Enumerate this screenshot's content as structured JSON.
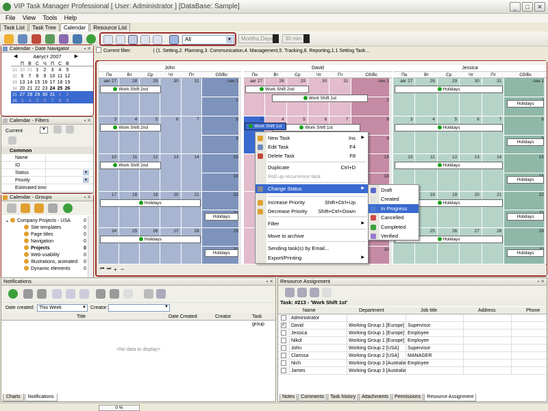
{
  "window": {
    "title": "VIP Task Manager Professional [ User: Administrator ] [DataBase: Sample]"
  },
  "menu": [
    "File",
    "View",
    "Tools",
    "Help"
  ],
  "tabs": [
    "Task List",
    "Task Tree",
    "Calendar",
    "Resource List"
  ],
  "toolbar": {
    "filter_value": "All",
    "view_mode": "Months,Days",
    "interval": "30 min"
  },
  "filter_bar": {
    "current_filter_label": "Current filter:",
    "filter_text": "( (1. Setting,2. Planning,3. Communication,4. Management,5. Tracking,6. Reporting,1.1 Setting Task..."
  },
  "date_navigator": {
    "title": "Calendar - Date Navigator",
    "month": "Август 2007",
    "weekdays": [
      "П",
      "В",
      "С",
      "Ч",
      "П",
      "С",
      "В"
    ],
    "weeks": [
      {
        "num": "31",
        "days": [
          "30",
          "31",
          "1",
          "2",
          "3",
          "4",
          "5"
        ]
      },
      {
        "num": "32",
        "days": [
          "6",
          "7",
          "8",
          "9",
          "10",
          "11",
          "12"
        ]
      },
      {
        "num": "33",
        "days": [
          "13",
          "14",
          "15",
          "16",
          "17",
          "18",
          "19"
        ]
      },
      {
        "num": "34",
        "days": [
          "20",
          "21",
          "22",
          "23",
          "24",
          "25",
          "26"
        ]
      },
      {
        "num": "35",
        "days": [
          "27",
          "28",
          "29",
          "30",
          "31",
          "1",
          "2"
        ]
      },
      {
        "num": "36",
        "days": [
          "3",
          "4",
          "5",
          "6",
          "7",
          "8",
          "9"
        ]
      }
    ]
  },
  "filters_panel": {
    "title": "Calendar - Filters",
    "current_label": "Current",
    "section": "Common",
    "fields": [
      "Name",
      "ID",
      "Status",
      "Priority",
      "Estimated time"
    ]
  },
  "groups_panel": {
    "title": "Calendar - Groups",
    "items": [
      {
        "label": "Company Projects - USA",
        "count": "0",
        "bold": false,
        "level": 0
      },
      {
        "label": "Site templates",
        "count": "0",
        "bold": false,
        "level": 1
      },
      {
        "label": "Page titles",
        "count": "0",
        "bold": false,
        "level": 1
      },
      {
        "label": "Navigation",
        "count": "0",
        "bold": false,
        "level": 1
      },
      {
        "label": "Projects",
        "count": "0",
        "bold": true,
        "level": 1
      },
      {
        "label": "Web-usability",
        "count": "0",
        "bold": false,
        "level": 1
      },
      {
        "label": "Illustrations, animated",
        "count": "0",
        "bold": false,
        "level": 1
      },
      {
        "label": "Dynamic elements",
        "count": "0",
        "bold": false,
        "level": 1
      }
    ]
  },
  "calendar": {
    "days": [
      "Пн",
      "Вт",
      "Ср",
      "Чт",
      "Пт",
      "Сб/Вс"
    ],
    "people": [
      {
        "name": "John",
        "color": "#a7b5d0",
        "weekend": "#7e93bb",
        "events": [
          [
            "Work Shift 2nd"
          ],
          [
            "Work Shift 2nd"
          ],
          [
            "Work Shift 2nd"
          ],
          [
            "Holidays"
          ],
          [
            "Holidays"
          ]
        ]
      },
      {
        "name": "David",
        "color": "#e2bccd",
        "weekend": "#c58ba4",
        "events": [
          [
            "Work Shift 2nd",
            "Work Shift 1st"
          ],
          [
            "Work Shift 1st"
          ],
          [],
          [],
          []
        ]
      },
      {
        "name": "Jessica",
        "color": "#b6d3c8",
        "weekend": "#8fb8a8",
        "events": [
          [
            "Holidays"
          ],
          [
            "Holidays"
          ],
          [
            "Holidays"
          ],
          [
            "Holidays"
          ],
          [
            "Holidays"
          ]
        ]
      }
    ],
    "weeks": [
      [
        "авг 27",
        "28",
        "29",
        "30",
        "31",
        "сен 1",
        "2"
      ],
      [
        "3",
        "4",
        "5",
        "6",
        "7",
        "8",
        "9"
      ],
      [
        "10",
        "11",
        "12",
        "13",
        "14",
        "15",
        "16"
      ],
      [
        "17",
        "18",
        "19",
        "20",
        "21",
        "22",
        "23"
      ],
      [
        "24",
        "25",
        "26",
        "27",
        "28",
        "29",
        "30"
      ]
    ]
  },
  "context_menu": {
    "items": [
      {
        "label": "New Task",
        "shortcut": "Ins",
        "arrow": true
      },
      {
        "label": "Edit Task",
        "shortcut": "F4",
        "arrow": false
      },
      {
        "label": "Delete Task",
        "shortcut": "F8",
        "arrow": false
      },
      {
        "label": "Duplicate",
        "shortcut": "Ctrl+D",
        "arrow": false
      },
      {
        "label": "Roll up recurrence task",
        "shortcut": "",
        "arrow": false
      },
      {
        "label": "Change Status",
        "shortcut": "",
        "arrow": true
      },
      {
        "label": "Increase Priority",
        "shortcut": "Shift+Ctrl+Up",
        "arrow": false
      },
      {
        "label": "Decrease Priority",
        "shortcut": "Shift+Ctrl+Down",
        "arrow": false
      },
      {
        "label": "Filter",
        "shortcut": "",
        "arrow": true
      },
      {
        "label": "Move to archive",
        "shortcut": "",
        "arrow": false
      },
      {
        "label": "Sending task(s) by Email...",
        "shortcut": "",
        "arrow": false
      },
      {
        "label": "Export/Printing",
        "shortcut": "",
        "arrow": true
      }
    ]
  },
  "status_submenu": [
    "Draft",
    "Created",
    "In Progress",
    "Cancelled",
    "Completed",
    "Verified"
  ],
  "notifications": {
    "title": "Notifications",
    "date_label": "Date created:",
    "date_value": "This Week",
    "creator_label": "Creator:",
    "columns": [
      "Title",
      "Date Created",
      "Creator",
      "Task group"
    ],
    "empty": "<No data to display>",
    "tabs": [
      "Charts",
      "Notifications"
    ]
  },
  "resources": {
    "title": "Resource Assignment",
    "task_title": "Task: #213 - 'Work Shift 1st'",
    "columns": [
      "Name",
      "Department",
      "Job title",
      "Address",
      "Phone"
    ],
    "rows": [
      {
        "check": "",
        "name": "Administrator",
        "dept": "",
        "job": ""
      },
      {
        "check": "✓",
        "name": "David",
        "dept": "Working Group 1 [Europe]",
        "job": "Supervisor"
      },
      {
        "check": "",
        "name": "Jessica",
        "dept": "Working Group 1 [Europe]",
        "job": "Employee"
      },
      {
        "check": "",
        "name": "Nikol",
        "dept": "Working Group 1 [Europe]",
        "job": "Employee"
      },
      {
        "check": "",
        "name": "John",
        "dept": "Working Group 2 [USA]",
        "job": "Supervisor"
      },
      {
        "check": "",
        "name": "Clarissa",
        "dept": "Working Group 2 [USA]",
        "job": "MANAGER"
      },
      {
        "check": "",
        "name": "Nich",
        "dept": "Working Group 3 [Australia]",
        "job": "Employee"
      },
      {
        "check": "",
        "name": "James",
        "dept": "Working Group 3 [Australia]",
        "job": ""
      }
    ],
    "tabs": [
      "Notes",
      "Comments",
      "Task history",
      "Attachments",
      "Permissions",
      "Resource Assignment"
    ]
  },
  "statusbar": {
    "progress": "0 %"
  },
  "colors": {
    "highlight": "#3a6ad0",
    "red_outline": "#9a2a2a"
  }
}
